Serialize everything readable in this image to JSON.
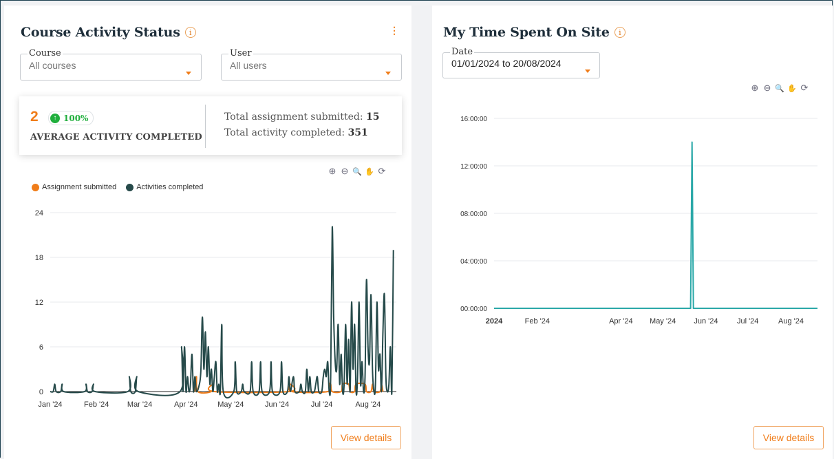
{
  "left": {
    "title": "Course Activity Status",
    "info_glyph": "i",
    "menu_glyph": "⋮",
    "course_select": {
      "legend": "Course",
      "value": "All courses"
    },
    "user_select": {
      "legend": "User",
      "value": "All users"
    },
    "summary": {
      "big_number": "2",
      "badge_arrow": "↑",
      "badge_text": "100%",
      "label": "AVERAGE ACTIVITY COMPLETED",
      "assign_label": "Total assignment submitted:",
      "assign_value": "15",
      "activity_label": "Total activity completed:",
      "activity_value": "351"
    },
    "toolbar": {
      "zoom_in": "⊕",
      "zoom_out": "⊖",
      "zoom": "🔍",
      "pan": "✋",
      "reset": "⟳"
    },
    "view_details": "View details"
  },
  "right": {
    "title": "My Time Spent On Site",
    "info_glyph": "i",
    "date_select": {
      "legend": "Date",
      "value": "01/01/2024 to 20/08/2024"
    },
    "toolbar": {
      "zoom_in": "⊕",
      "zoom_out": "⊖",
      "zoom": "🔍",
      "pan": "✋",
      "reset": "⟳"
    },
    "view_details": "View details"
  },
  "colors": {
    "accent": "#f07d1a",
    "activities": "#264a4a",
    "assignment": "#f07d1a",
    "time_line": "#2aa8a8",
    "green": "#1fae3c"
  },
  "chart_data": [
    {
      "type": "line",
      "series": [
        {
          "name": "Assignment submitted",
          "color": "#f07d1a",
          "points": [
            [
              "2024-04-07",
              0
            ],
            [
              "2024-04-08",
              2
            ],
            [
              "2024-04-09",
              0
            ],
            [
              "2024-04-18",
              0
            ],
            [
              "2024-04-19",
              1
            ],
            [
              "2024-04-20",
              0
            ],
            [
              "2024-06-09",
              0
            ],
            [
              "2024-06-10",
              1
            ],
            [
              "2024-06-11",
              0
            ],
            [
              "2024-07-05",
              0
            ],
            [
              "2024-07-06",
              1
            ],
            [
              "2024-07-07",
              1
            ],
            [
              "2024-07-08",
              0
            ],
            [
              "2024-07-14",
              0
            ],
            [
              "2024-07-15",
              1
            ],
            [
              "2024-07-19",
              1
            ],
            [
              "2024-07-20",
              0
            ],
            [
              "2024-07-23",
              0
            ],
            [
              "2024-07-24",
              1
            ],
            [
              "2024-07-30",
              1
            ],
            [
              "2024-07-31",
              0
            ],
            [
              "2024-08-03",
              0
            ],
            [
              "2024-08-04",
              1
            ],
            [
              "2024-08-05",
              0
            ],
            [
              "2024-08-09",
              0
            ],
            [
              "2024-08-10",
              1
            ],
            [
              "2024-08-11",
              0
            ]
          ]
        },
        {
          "name": "Activities completed",
          "color": "#264a4a",
          "points": [
            [
              "2024-01-01",
              0
            ],
            [
              "2024-01-03",
              0
            ],
            [
              "2024-01-04",
              1
            ],
            [
              "2024-01-05",
              0
            ],
            [
              "2024-01-08",
              0
            ],
            [
              "2024-01-09",
              1
            ],
            [
              "2024-01-10",
              0
            ],
            [
              "2024-01-24",
              0
            ],
            [
              "2024-01-25",
              1
            ],
            [
              "2024-01-26",
              0
            ],
            [
              "2024-01-29",
              0
            ],
            [
              "2024-01-30",
              1
            ],
            [
              "2024-01-31",
              0
            ],
            [
              "2024-02-22",
              0
            ],
            [
              "2024-02-23",
              2
            ],
            [
              "2024-02-24",
              0
            ],
            [
              "2024-02-27",
              0
            ],
            [
              "2024-02-28",
              2
            ],
            [
              "2024-02-29",
              0
            ],
            [
              "2024-03-28",
              0
            ],
            [
              "2024-03-29",
              6
            ],
            [
              "2024-03-30",
              0
            ],
            [
              "2024-03-31",
              6
            ],
            [
              "2024-04-01",
              0
            ],
            [
              "2024-04-02",
              2
            ],
            [
              "2024-04-03",
              0
            ],
            [
              "2024-04-04",
              1
            ],
            [
              "2024-04-05",
              5
            ],
            [
              "2024-04-06",
              0
            ],
            [
              "2024-04-07",
              2
            ],
            [
              "2024-04-08",
              0
            ],
            [
              "2024-04-10",
              1
            ],
            [
              "2024-04-11",
              3
            ],
            [
              "2024-04-12",
              10
            ],
            [
              "2024-04-13",
              3
            ],
            [
              "2024-04-14",
              8
            ],
            [
              "2024-04-15",
              2
            ],
            [
              "2024-04-16",
              6
            ],
            [
              "2024-04-17",
              1
            ],
            [
              "2024-04-18",
              3
            ],
            [
              "2024-04-19",
              0
            ],
            [
              "2024-04-20",
              2
            ],
            [
              "2024-04-21",
              4
            ],
            [
              "2024-04-22",
              0
            ],
            [
              "2024-04-23",
              1
            ],
            [
              "2024-04-24",
              0
            ],
            [
              "2024-04-25",
              9
            ],
            [
              "2024-04-26",
              0
            ],
            [
              "2024-05-03",
              0
            ],
            [
              "2024-05-04",
              4
            ],
            [
              "2024-05-05",
              0
            ],
            [
              "2024-05-08",
              0
            ],
            [
              "2024-05-09",
              1
            ],
            [
              "2024-05-10",
              0
            ],
            [
              "2024-05-14",
              0
            ],
            [
              "2024-05-15",
              4
            ],
            [
              "2024-05-16",
              0
            ],
            [
              "2024-05-20",
              0
            ],
            [
              "2024-05-21",
              4
            ],
            [
              "2024-05-22",
              0
            ],
            [
              "2024-05-27",
              0
            ],
            [
              "2024-05-28",
              4
            ],
            [
              "2024-05-29",
              0
            ],
            [
              "2024-06-03",
              0
            ],
            [
              "2024-06-04",
              4
            ],
            [
              "2024-06-05",
              0
            ],
            [
              "2024-06-08",
              0
            ],
            [
              "2024-06-09",
              2
            ],
            [
              "2024-06-10",
              0
            ],
            [
              "2024-06-12",
              2
            ],
            [
              "2024-06-13",
              0
            ],
            [
              "2024-06-16",
              0
            ],
            [
              "2024-06-17",
              1
            ],
            [
              "2024-06-18",
              0
            ],
            [
              "2024-06-20",
              0
            ],
            [
              "2024-06-21",
              3
            ],
            [
              "2024-06-22",
              0
            ],
            [
              "2024-06-23",
              2
            ],
            [
              "2024-06-24",
              0
            ],
            [
              "2024-06-26",
              0
            ],
            [
              "2024-06-27",
              1
            ],
            [
              "2024-06-28",
              2
            ],
            [
              "2024-06-29",
              0
            ],
            [
              "2024-07-01",
              0
            ],
            [
              "2024-07-02",
              2
            ],
            [
              "2024-07-03",
              3
            ],
            [
              "2024-07-04",
              2
            ],
            [
              "2024-07-05",
              4
            ],
            [
              "2024-07-06",
              0
            ],
            [
              "2024-07-07",
              2
            ],
            [
              "2024-07-08",
              22
            ],
            [
              "2024-07-09",
              10
            ],
            [
              "2024-07-10",
              4
            ],
            [
              "2024-07-11",
              3
            ],
            [
              "2024-07-12",
              9
            ],
            [
              "2024-07-13",
              1
            ],
            [
              "2024-07-14",
              5
            ],
            [
              "2024-07-15",
              0
            ],
            [
              "2024-07-16",
              1
            ],
            [
              "2024-07-17",
              9
            ],
            [
              "2024-07-18",
              1
            ],
            [
              "2024-07-19",
              7
            ],
            [
              "2024-07-20",
              0
            ],
            [
              "2024-07-21",
              12
            ],
            [
              "2024-07-22",
              3
            ],
            [
              "2024-07-23",
              9
            ],
            [
              "2024-07-24",
              0
            ],
            [
              "2024-07-25",
              2
            ],
            [
              "2024-07-26",
              12
            ],
            [
              "2024-07-27",
              1
            ],
            [
              "2024-07-28",
              4
            ],
            [
              "2024-07-29",
              0
            ],
            [
              "2024-07-30",
              2
            ],
            [
              "2024-07-31",
              15
            ],
            [
              "2024-08-01",
              6
            ],
            [
              "2024-08-02",
              4
            ],
            [
              "2024-08-03",
              13
            ],
            [
              "2024-08-04",
              3
            ],
            [
              "2024-08-05",
              0
            ],
            [
              "2024-08-06",
              1
            ],
            [
              "2024-08-07",
              12
            ],
            [
              "2024-08-08",
              3
            ],
            [
              "2024-08-09",
              5
            ],
            [
              "2024-08-10",
              0
            ],
            [
              "2024-08-11",
              8
            ],
            [
              "2024-08-12",
              13
            ],
            [
              "2024-08-13",
              2
            ],
            [
              "2024-08-14",
              0
            ],
            [
              "2024-08-15",
              1
            ],
            [
              "2024-08-16",
              6
            ],
            [
              "2024-08-17",
              0
            ],
            [
              "2024-08-18",
              19
            ]
          ]
        }
      ],
      "x_ticks": [
        [
          "2024-01-01",
          "Jan '24"
        ],
        [
          "2024-02-01",
          "Feb '24"
        ],
        [
          "2024-03-01",
          "Mar '24"
        ],
        [
          "2024-04-01",
          "Apr '24"
        ],
        [
          "2024-05-01",
          "May '24"
        ],
        [
          "2024-06-01",
          "Jun '24"
        ],
        [
          "2024-07-01",
          "Jul '24"
        ],
        [
          "2024-08-01",
          "Aug '24"
        ]
      ],
      "x_range": [
        "2024-01-01",
        "2024-08-20"
      ],
      "y_ticks": [
        0,
        6,
        12,
        18,
        24
      ],
      "ylim": [
        0,
        24
      ],
      "grid": true,
      "legend": "top-left"
    },
    {
      "type": "line",
      "series": [
        {
          "color": "#2aa8a8",
          "points": [
            [
              "2024-01-01",
              "00:00:00"
            ],
            [
              "2024-05-21",
              "00:00:00"
            ],
            [
              "2024-05-22",
              "14:00:00"
            ],
            [
              "2024-05-23",
              "00:00:00"
            ],
            [
              "2024-08-20",
              "00:00:00"
            ]
          ]
        }
      ],
      "x_ticks": [
        [
          "2024-01-01",
          "2024"
        ],
        [
          "2024-02-01",
          "Feb '24"
        ],
        [
          "2024-04-01",
          "Apr '24"
        ],
        [
          "2024-05-01",
          "May '24"
        ],
        [
          "2024-06-01",
          "Jun '24"
        ],
        [
          "2024-07-01",
          "Jul '24"
        ],
        [
          "2024-08-01",
          "Aug '24"
        ]
      ],
      "x_range": [
        "2024-01-01",
        "2024-08-20"
      ],
      "y_ticks": [
        "00:00:00",
        "04:00:00",
        "08:00:00",
        "12:00:00",
        "16:00:00"
      ],
      "ylim": [
        "00:00:00",
        "16:00:00"
      ],
      "grid": true
    }
  ]
}
